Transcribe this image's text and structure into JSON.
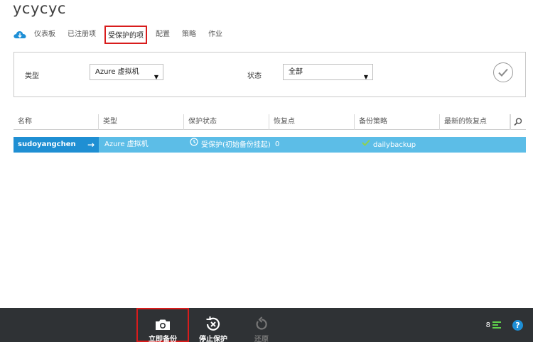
{
  "title": "ycycyc",
  "nav": {
    "tabs": [
      {
        "label": "仪表板"
      },
      {
        "label": "已注册项"
      },
      {
        "label": "受保护的项",
        "active": true
      },
      {
        "label": "配置"
      },
      {
        "label": "策略"
      },
      {
        "label": "作业"
      }
    ]
  },
  "filter": {
    "type_label": "类型",
    "type_value": "Azure 虚拟机",
    "status_label": "状态",
    "status_value": "全部"
  },
  "table": {
    "columns": [
      "名称",
      "类型",
      "保护状态",
      "恢复点",
      "备份策略",
      "最新的恢复点"
    ],
    "rows": [
      {
        "name": "sudoyangchen",
        "type": "Azure 虚拟机",
        "protection_status": "受保护(初始备份挂起)",
        "recovery_points": "0",
        "backup_policy": "dailybackup",
        "latest_recovery_point": ""
      }
    ]
  },
  "commands": {
    "backup_now": "立即备份",
    "stop_protection": "停止保护",
    "restore": "还原"
  },
  "status_bar": {
    "count": "8",
    "help": "?"
  },
  "colors": {
    "selected_row": "#5cbde7",
    "selected_name_cell": "#1f8fd3",
    "bottom_bar": "#2f3235",
    "highlight_box": "#d81c1c"
  }
}
